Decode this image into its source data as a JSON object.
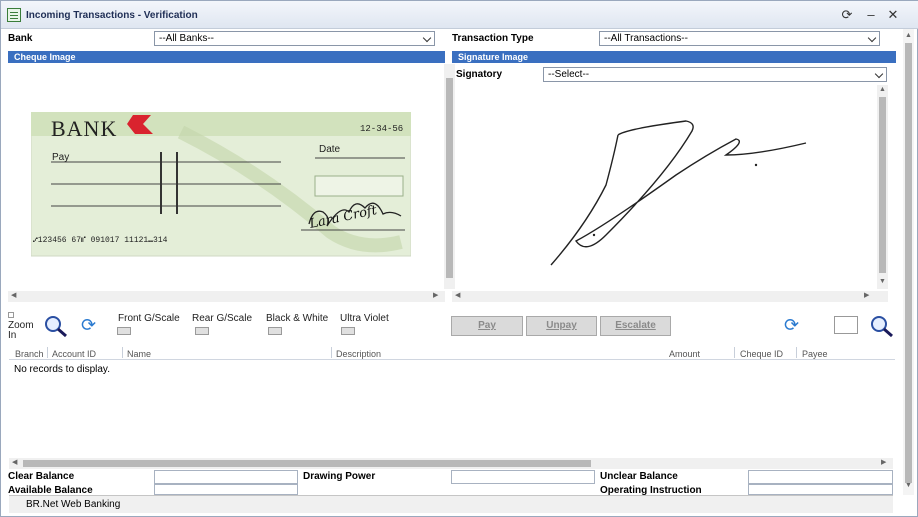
{
  "window": {
    "title": "Incoming Transactions - Verification"
  },
  "filters": {
    "bank_label": "Bank",
    "bank_value": "--All Banks--",
    "type_label": "Transaction Type",
    "type_value": "--All Transactions--"
  },
  "cheque_panel": {
    "header": "Cheque Image",
    "cheque": {
      "bank_name": "BANK",
      "sort_code": "12-34-56",
      "pay_label": "Pay",
      "date_label": "Date",
      "micr": "⑇123456 67⑈ 091017 11121⑉314",
      "signature": "Lara Croft"
    }
  },
  "signature_panel": {
    "header": "Signature Image",
    "signatory_label": "Signatory",
    "signatory_value": "--Select--"
  },
  "toolbar": {
    "zoom_in_label": "Zoom In",
    "front_label": "Front G/Scale",
    "rear_label": "Rear G/Scale",
    "bw_label": "Black & White",
    "uv_label": "Ultra Violet",
    "pay_label": "Pay",
    "unpay_label": "Unpay",
    "escalate_label": "Escalate"
  },
  "grid": {
    "columns": [
      "Branch",
      "Account ID",
      "Name",
      "Description",
      "Amount",
      "Cheque ID",
      "Payee"
    ],
    "empty_text": "No records to display."
  },
  "footer": {
    "clear_balance": "Clear Balance",
    "drawing_power": "Drawing Power",
    "unclear_balance": "Unclear Balance",
    "available_balance": "Available Balance",
    "operating_instruction": "Operating Instruction"
  },
  "status": {
    "text": "BR.Net Web Banking"
  },
  "colors": {
    "header_bar": "#3a6fc0",
    "bank_red": "#d9232e",
    "cheque_green": "#d8e8c4"
  }
}
